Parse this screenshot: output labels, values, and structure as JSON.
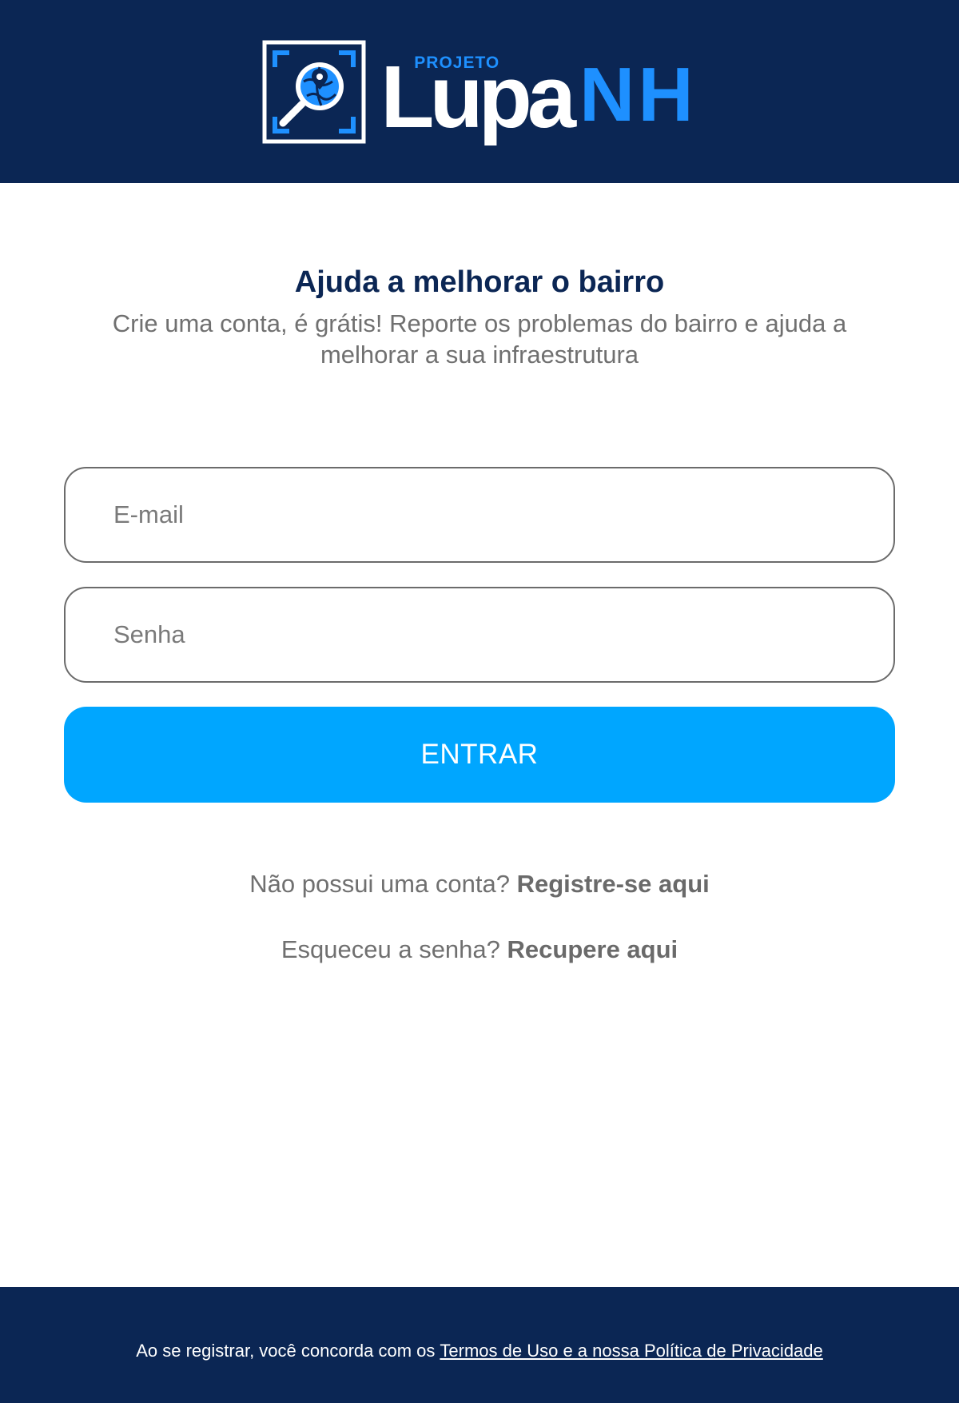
{
  "header": {
    "logo_small": "PROJETO",
    "logo_main": "Lupa",
    "logo_accent": "NH"
  },
  "intro": {
    "title": "Ajuda a melhorar o bairro",
    "subtitle": "Crie uma conta, é grátis! Reporte os problemas do bairro e ajuda a melhorar a sua infraestrutura"
  },
  "form": {
    "email_placeholder": "E-mail",
    "email_value": "",
    "password_placeholder": "Senha",
    "password_value": "",
    "submit_label": "ENTRAR"
  },
  "links": {
    "register_prompt": "Não possui uma conta?",
    "register_link": "Registre-se aqui",
    "recover_prompt": "Esqueceu a senha?",
    "recover_link": "Recupere aqui"
  },
  "footer": {
    "text": "Ao se registrar, você concorda com os",
    "terms_link": "Termos de Uso e a nossa Política de Privacidade"
  },
  "colors": {
    "navy": "#0b2654",
    "accent_blue": "#00a6ff",
    "logo_blue": "#1e90ff",
    "muted_text": "#707070"
  },
  "icons": {
    "logo": "magnifier-globe-icon"
  }
}
